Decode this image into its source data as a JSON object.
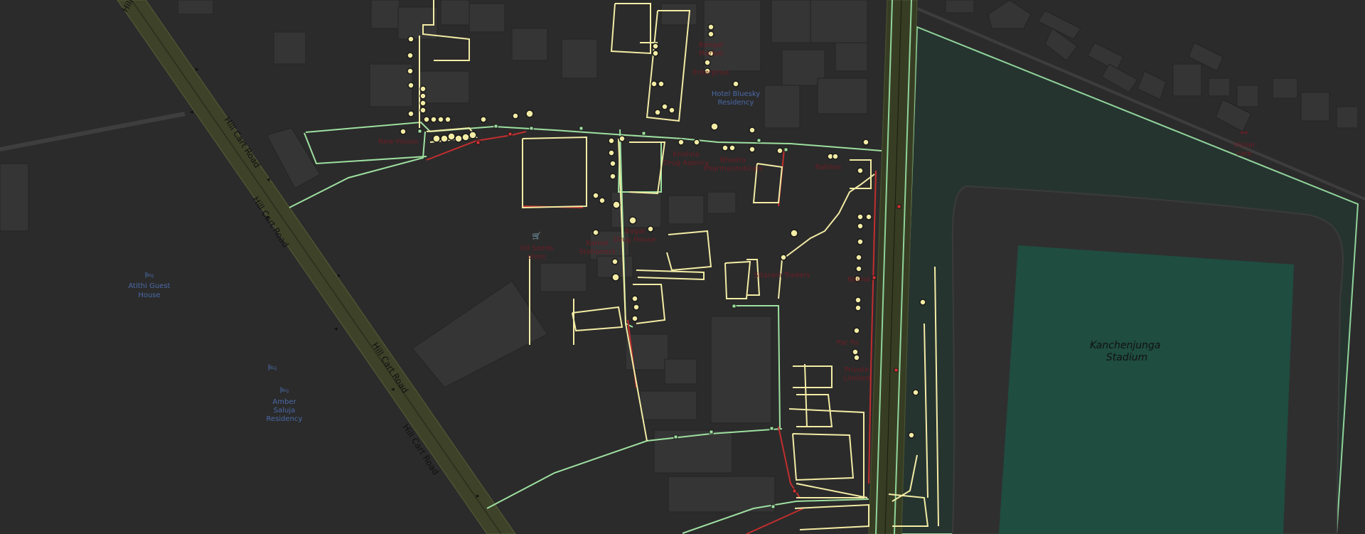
{
  "map": {
    "roads": {
      "hill_cart_road": "Hill Cart Road"
    },
    "landmarks": {
      "stadium": "Kanchenjunga\nStadium"
    },
    "pois": {
      "athithi": "Atithi Guest\nHouse",
      "amber": "Amber\nSaluja\nResidency",
      "hotel_bluesky": "Hotel Bluesky\nResidency",
      "bengal": "Bengal\nMarket",
      "bhadra": "Bhadra\nPharmaceuticals",
      "oil_seeds": "Oil Seeds\nstore",
      "kamal": "Kamal\nStationers",
      "bagal": "Bagal\nDrug House",
      "new_house": "New House",
      "rakhee": "Rakhee",
      "nilima": "Nilima",
      "par": "Par Pa",
      "private_limited": "Private\nLimited",
      "traders": "Sitaram Traders",
      "enterprise": "Enterprise",
      "vision": "Vision\ncare",
      "krishna": "Krishna\nDrug Agency"
    }
  },
  "colors": {
    "background": "#2b2b2b",
    "building": "#3a3a3a",
    "stadium_ground": "#213530",
    "pitch": "#1e5245",
    "footway": "#f7f3b0",
    "path_green": "#9ee0a0",
    "path_red": "#d43131",
    "trunk_road": "#3a4028",
    "poi_blue": "#4a6aa8",
    "poi_red": "#a8324a"
  }
}
